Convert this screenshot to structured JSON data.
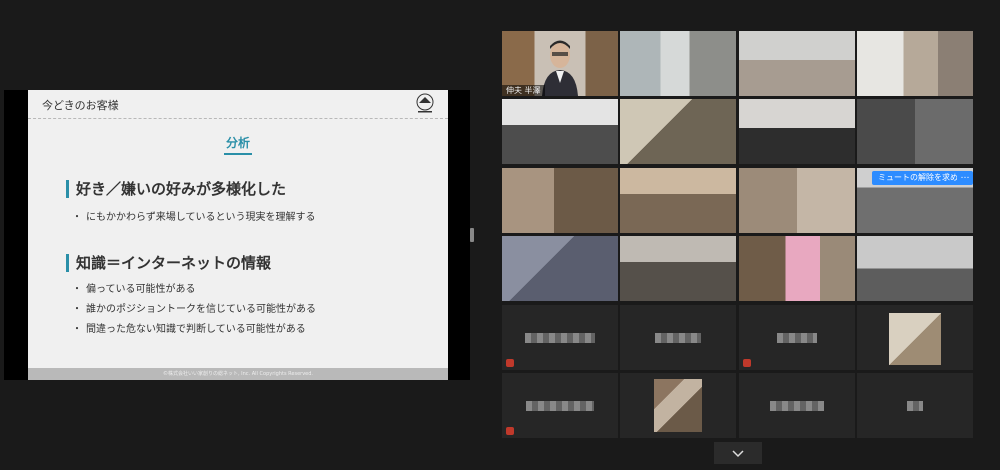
{
  "slide": {
    "title": "今どきのお客様",
    "heading": "分析",
    "section1": "好き／嫌いの好みが多様化した",
    "section1_bullets": [
      "にもかかわらず来場しているという現実を理解する"
    ],
    "section2": "知識＝インターネットの情報",
    "section2_bullets": [
      "偏っている可能性がある",
      "誰かのポジショントークを信じている可能性がある",
      "間違った危ない知識で判断している可能性がある"
    ],
    "bullet_mark": "・",
    "footer": "©株式会社いい家創りの総ネット, Inc. All Copyrights Reserved."
  },
  "gallery": {
    "active_speaker_name": "伸夫 半澤",
    "request_unmute_label": "ミュートの解除を求める",
    "more_label": "…",
    "scroll_down_icon": "chevron-down-icon"
  },
  "colors": {
    "accent": "#2a8fa8",
    "active_outline": "#d8e100",
    "button_blue": "#2d8cff"
  }
}
